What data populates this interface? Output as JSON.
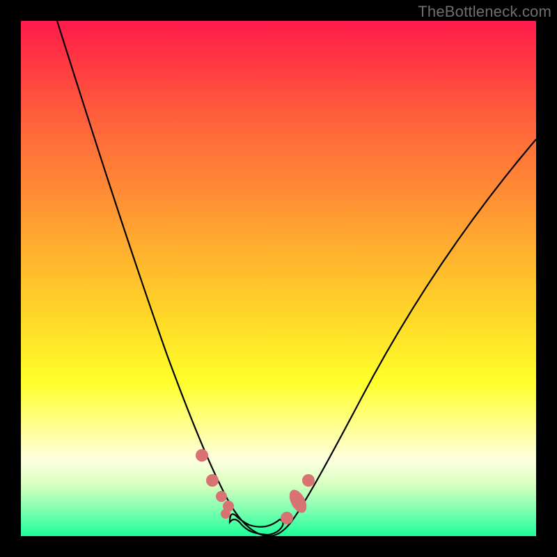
{
  "watermark": "TheBottleneck.com",
  "colors": {
    "background": "#000000",
    "curve": "#000000",
    "dots": "#d97272",
    "gradient_top": "#ff1a4b",
    "gradient_bottom": "#1cff99"
  },
  "chart_data": {
    "type": "line",
    "title": "",
    "xlabel": "",
    "ylabel": "",
    "xlim": [
      0,
      100
    ],
    "ylim": [
      0,
      100
    ],
    "grid": false,
    "legend": false,
    "annotations": [
      "TheBottleneck.com"
    ],
    "series": [
      {
        "name": "curve",
        "x": [
          7,
          10,
          15,
          20,
          25,
          28,
          30,
          32,
          34,
          36,
          38,
          40,
          43,
          46,
          48,
          50,
          55,
          60,
          65,
          70,
          75,
          80,
          85,
          90,
          95,
          100
        ],
        "y": [
          100,
          88,
          70,
          55,
          40,
          32,
          26,
          21,
          16,
          12,
          8,
          5,
          2,
          0,
          0,
          1,
          4,
          9,
          15,
          22,
          29,
          36,
          43,
          50,
          56,
          62
        ]
      }
    ],
    "markers": [
      {
        "name": "left-dot-1",
        "x": 35,
        "y": 15
      },
      {
        "name": "left-dot-2",
        "x": 37,
        "y": 10
      },
      {
        "name": "left-cluster-top",
        "x": 39,
        "y": 7
      },
      {
        "name": "bottom-start",
        "x": 41,
        "y": 3
      },
      {
        "name": "bottom-seg-1",
        "x": 43,
        "y": 1
      },
      {
        "name": "bottom-seg-2",
        "x": 45,
        "y": 0
      },
      {
        "name": "bottom-seg-3",
        "x": 47,
        "y": 0
      },
      {
        "name": "bottom-end",
        "x": 49,
        "y": 1
      },
      {
        "name": "right-dot-1",
        "x": 51,
        "y": 3
      },
      {
        "name": "right-blob-lower",
        "x": 53,
        "y": 6
      },
      {
        "name": "right-blob-upper",
        "x": 54,
        "y": 8
      },
      {
        "name": "right-dot-2",
        "x": 56,
        "y": 11
      }
    ]
  }
}
